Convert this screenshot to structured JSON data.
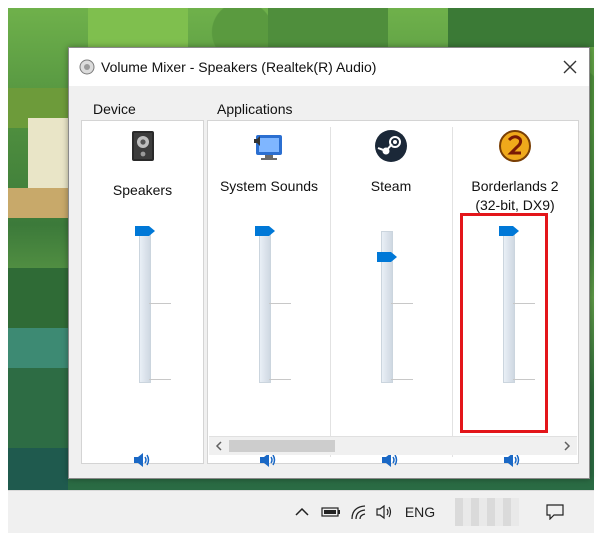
{
  "window": {
    "title": "Volume Mixer - Speakers (Realtek(R) Audio)",
    "close_icon": "close-icon"
  },
  "device_group": {
    "label": "Device",
    "name": "Speakers",
    "volume_percent": 100,
    "icon": "speaker-device-icon"
  },
  "applications_group": {
    "label": "Applications",
    "apps": [
      {
        "name": "System Sounds",
        "volume_percent": 100,
        "icon": "system-sounds-icon"
      },
      {
        "name": "Steam",
        "volume_percent": 83,
        "icon": "steam-icon"
      },
      {
        "name": "Borderlands 2\n(32-bit, DX9)",
        "volume_percent": 100,
        "icon": "borderlands2-icon"
      }
    ]
  },
  "taskbar": {
    "language": "ENG",
    "icons": [
      "chevron-up-icon",
      "battery-icon",
      "wifi-icon",
      "volume-icon",
      "notification-icon"
    ]
  },
  "colors": {
    "accent": "#0078d7",
    "highlight": "#e3151a"
  }
}
